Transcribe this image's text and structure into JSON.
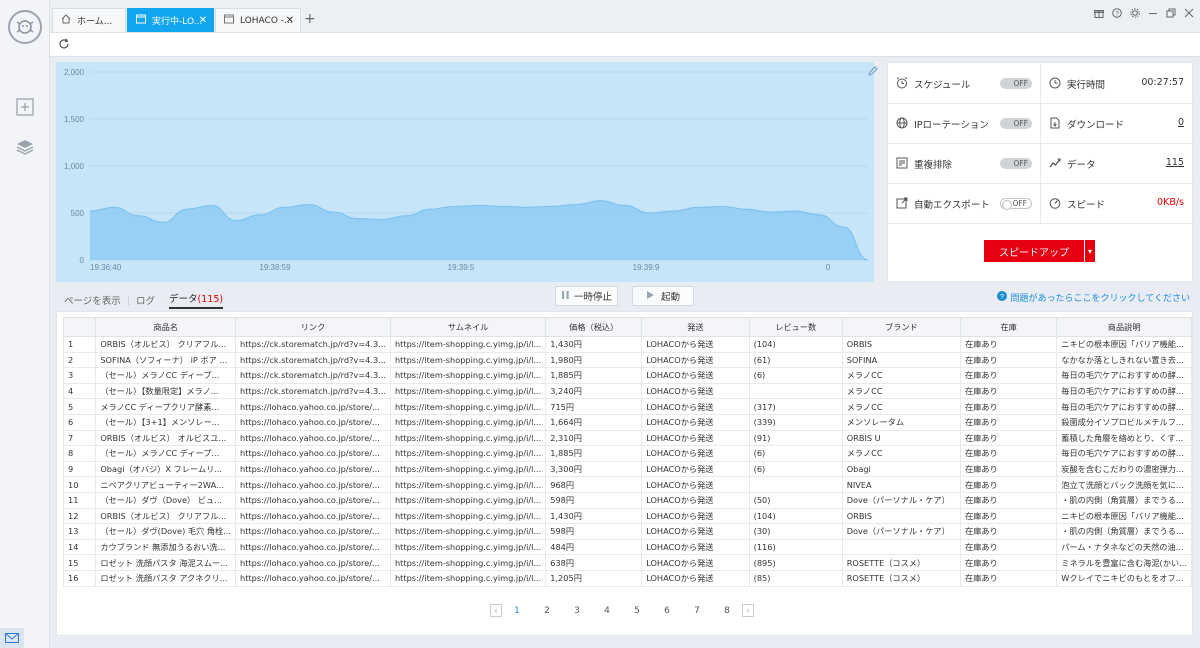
{
  "tabs": [
    {
      "label": "ホーム..."
    },
    {
      "label": "実行中-LO..."
    },
    {
      "label": "LOHACO -..."
    }
  ],
  "colors": {
    "accent": "#12a6ee",
    "danger": "#e60012",
    "chart_fill": "#8fcdf4"
  },
  "chart_data": {
    "type": "area",
    "x_ticks": [
      "19:36:40",
      "19:38:59",
      "19:39:5",
      "19:39:9",
      "0"
    ],
    "y_ticks": [
      "2,000",
      "1,500",
      "1,000",
      "500",
      "0"
    ],
    "ylim": [
      0,
      2000
    ],
    "points": [
      520,
      560,
      470,
      400,
      540,
      580,
      420,
      480,
      560,
      590,
      510,
      440,
      430,
      470,
      540,
      570,
      580,
      570,
      560,
      570,
      590,
      630,
      580,
      500,
      520,
      560,
      570,
      540,
      510,
      520,
      480,
      350,
      0
    ]
  },
  "stats": {
    "schedule": {
      "label": "スケジュール",
      "toggle": "OFF"
    },
    "runtime": {
      "label": "実行時間",
      "value": "00:27:57"
    },
    "ip_rotation": {
      "label": "IPローテーション",
      "toggle": "OFF"
    },
    "download": {
      "label": "ダウンロード",
      "value": "0"
    },
    "dedupe": {
      "label": "重複排除",
      "toggle": "OFF"
    },
    "data": {
      "label": "データ",
      "value": "115"
    },
    "auto_export": {
      "label": "自動エクスポート",
      "toggle": "OFF"
    },
    "speed": {
      "label": "スピード",
      "value": "0KB/s"
    },
    "speedup_button": "スピードアップ"
  },
  "subtabs": {
    "page_view": "ページを表示",
    "log": "ログ",
    "data": "データ",
    "data_count": "(115)"
  },
  "controls": {
    "pause": "一時停止",
    "start": "起動",
    "help": "問題があったらここをクリックしてください"
  },
  "table": {
    "headers": [
      "",
      "商品名",
      "リンク",
      "サムネイル",
      "価格（税込）",
      "発送",
      "レビュー数",
      "ブランド",
      "在庫",
      "商品説明"
    ],
    "rows": [
      [
        "1",
        "ORBIS（オルビス） クリアフル...",
        "https://ck.storematch.jp/rd?v=4.3...",
        "https://item-shopping.c.yimg.jp/i/l...",
        "1,430円",
        "LOHACOから発送",
        "(104)",
        "ORBIS",
        "在庫あり",
        "ニキビの根本原因「バリア機能..."
      ],
      [
        "2",
        "SOFINA（ソフィーナ） iP ボア ...",
        "https://ck.storematch.jp/rd?v=4.3...",
        "https://item-shopping.c.yimg.jp/i/l...",
        "1,980円",
        "LOHACOから発送",
        "(61)",
        "SOFINA",
        "在庫あり",
        "なかなか落としきれない置き去..."
      ],
      [
        "3",
        "（セール）メラノCC ディープ...",
        "https://ck.storematch.jp/rd?v=4.3...",
        "https://item-shopping.c.yimg.jp/i/l...",
        "1,885円",
        "LOHACOから発送",
        "(6)",
        "メラノCC",
        "在庫あり",
        "毎日の毛穴ケアにおすすめの酵..."
      ],
      [
        "4",
        "（セール）【数量限定】メラノ...",
        "https://ck.storematch.jp/rd?v=4.3...",
        "https://item-shopping.c.yimg.jp/i/l...",
        "3,240円",
        "LOHACOから発送",
        "",
        "メラノCC",
        "在庫あり",
        "毎日の毛穴ケアにおすすめの酵..."
      ],
      [
        "5",
        "メラノCC ディープクリア酵素...",
        "https://lohaco.yahoo.co.jp/store/...",
        "https://item-shopping.c.yimg.jp/i/l...",
        "715円",
        "LOHACOから発送",
        "(317)",
        "メラノCC",
        "在庫あり",
        "毎日の毛穴ケアにおすすめの酵..."
      ],
      [
        "6",
        "（セール）【3+1】メンソレー...",
        "https://lohaco.yahoo.co.jp/store/...",
        "https://item-shopping.c.yimg.jp/i/l...",
        "1,664円",
        "LOHACOから発送",
        "(339)",
        "メンソレータム",
        "在庫あり",
        "殺菌成分イソプロピルメチルフ..."
      ],
      [
        "7",
        "ORBIS（オルビス） オルビスユ...",
        "https://lohaco.yahoo.co.jp/store/...",
        "https://item-shopping.c.yimg.jp/i/l...",
        "2,310円",
        "LOHACOから発送",
        "(91)",
        "ORBIS U",
        "在庫あり",
        "蓄積した角層を絡めとり、くす..."
      ],
      [
        "8",
        "（セール）メラノCC ディープ...",
        "https://lohaco.yahoo.co.jp/store/...",
        "https://item-shopping.c.yimg.jp/i/l...",
        "1,885円",
        "LOHACOから発送",
        "(6)",
        "メラノCC",
        "在庫あり",
        "毎日の毛穴ケアにおすすめの酵..."
      ],
      [
        "9",
        "Obagi（オバジ）X フレームリ...",
        "https://lohaco.yahoo.co.jp/store/...",
        "https://item-shopping.c.yimg.jp/i/l...",
        "3,300円",
        "LOHACOから発送",
        "(6)",
        "Obagi",
        "在庫あり",
        "炭酸を含むこだわりの濃密弾力..."
      ],
      [
        "10",
        "ニベアクリアビューティー2WA...",
        "https://lohaco.yahoo.co.jp/store/...",
        "https://item-shopping.c.yimg.jp/i/l...",
        "968円",
        "LOHACOから発送",
        "",
        "NIVEA",
        "在庫あり",
        "泡立て洗顔とパック洗顔を気に..."
      ],
      [
        "11",
        "（セール）ダヴ（Dove） ビュ...",
        "https://lohaco.yahoo.co.jp/store/...",
        "https://item-shopping.c.yimg.jp/i/l...",
        "598円",
        "LOHACOから発送",
        "(50)",
        "Dove（パーソナル・ケア）",
        "在庫あり",
        "・肌の内側（角質層）までうる..."
      ],
      [
        "12",
        "ORBIS（オルビス） クリアフル...",
        "https://lohaco.yahoo.co.jp/store/...",
        "https://item-shopping.c.yimg.jp/i/l...",
        "1,430円",
        "LOHACOから発送",
        "(104)",
        "ORBIS",
        "在庫あり",
        "ニキビの根本原因「バリア機能..."
      ],
      [
        "13",
        "（セール）ダヴ(Dove) 毛穴 角栓...",
        "https://lohaco.yahoo.co.jp/store/...",
        "https://item-shopping.c.yimg.jp/i/l...",
        "598円",
        "LOHACOから発送",
        "(30)",
        "Dove（パーソナル・ケア）",
        "在庫あり",
        "・肌の内側（角質層）までうる..."
      ],
      [
        "14",
        "カウブランド 無添加うるおい洗...",
        "https://lohaco.yahoo.co.jp/store/...",
        "https://item-shopping.c.yimg.jp/i/l...",
        "484円",
        "LOHACOから発送",
        "(116)",
        "",
        "在庫あり",
        "パーム・ナタネなどの天然の油..."
      ],
      [
        "15",
        "ロゼット 洗顔パスタ 海泥スムー...",
        "https://lohaco.yahoo.co.jp/store/...",
        "https://item-shopping.c.yimg.jp/i/l...",
        "638円",
        "LOHACOから発送",
        "(895)",
        "ROSETTE（コスメ）",
        "在庫あり",
        "ミネラルを豊富に含む海泥(かい..."
      ],
      [
        "16",
        "ロゼット 洗顔パスタ アクネクリ...",
        "https://lohaco.yahoo.co.jp/store/...",
        "https://item-shopping.c.yimg.jp/i/l...",
        "1,205円",
        "LOHACOから発送",
        "(85)",
        "ROSETTE（コスメ）",
        "在庫あり",
        "Wクレイでニキビのもとをオフ..."
      ]
    ]
  },
  "pagination": {
    "pages": [
      "1",
      "2",
      "3",
      "4",
      "5",
      "6",
      "7",
      "8"
    ],
    "current": "1"
  }
}
